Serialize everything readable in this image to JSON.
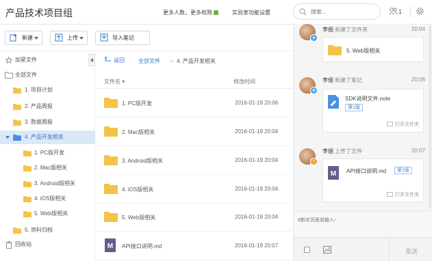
{
  "header": {
    "app_title": "产品技术项目组",
    "more_people_link": "更多人数，更多权限",
    "labs_link": "实验室功能设置",
    "search_placeholder": "搜索...",
    "member_count": "1"
  },
  "toolbar": {
    "new_label": "新建",
    "upload_label": "上传",
    "import_label": "导入笔记"
  },
  "sidebar": {
    "items": [
      {
        "label": "加星文件",
        "icon": "star-icon"
      },
      {
        "label": "全部文件",
        "icon": "folder-outline-icon"
      },
      {
        "label": "1. 项目计划",
        "icon": "folder-icon"
      },
      {
        "label": "2. 产品周报",
        "icon": "folder-icon"
      },
      {
        "label": "3. 数据周报",
        "icon": "folder-icon"
      },
      {
        "label": "4. 产品开发相关",
        "icon": "folder-open-icon",
        "active": true
      },
      {
        "label": "1. PC版开发",
        "icon": "folder-icon"
      },
      {
        "label": "2. Mac版相关",
        "icon": "folder-icon"
      },
      {
        "label": "3. Android版相关",
        "icon": "folder-icon"
      },
      {
        "label": "4. iOS版相关",
        "icon": "folder-icon"
      },
      {
        "label": "5. Web版相关",
        "icon": "folder-icon"
      },
      {
        "label": "5. 资料归档",
        "icon": "folder-icon"
      },
      {
        "label": "回收站",
        "icon": "trash-icon"
      }
    ]
  },
  "breadcrumb": {
    "back_label": "返回",
    "all_label": "全部文件",
    "arrow": "→",
    "current_label": "4. 产品开发相关"
  },
  "file_list": {
    "col_name": "文件名 ▾",
    "col_time": "修改时间",
    "rows": [
      {
        "name": "1. PC版开发",
        "time": "2016-01-19 20:06",
        "type": "folder"
      },
      {
        "name": "2. Mac版相关",
        "time": "2016-01-19 20:04",
        "type": "folder"
      },
      {
        "name": "3. Android版相关",
        "time": "2016-01-19 20:04",
        "type": "folder"
      },
      {
        "name": "4. iOS版相关",
        "time": "2016-01-19 20:04",
        "type": "folder"
      },
      {
        "name": "5. Web版相关",
        "time": "2016-01-19 20:04",
        "type": "folder"
      },
      {
        "name": "API接口说明.md",
        "time": "2016-01-19 20:07",
        "type": "markdown"
      }
    ]
  },
  "activity": {
    "items": [
      {
        "user": "李倔",
        "action": "新建了文件夹",
        "time": "20:04",
        "file": "5. Web版相关"
      },
      {
        "user": "李倔",
        "action": "新建了笔记",
        "time": "20:06",
        "file": "SDK说明文件.note",
        "version": "第1版",
        "open_folder": "打开文件夹"
      },
      {
        "user": "李倔",
        "action": "上传了文件",
        "time": "20:07",
        "file": "API接口说明.md",
        "version": "第1版",
        "open_folder": "打开文件夹"
      }
    ]
  },
  "comment": {
    "placeholder": "#新欢页面说输入~",
    "send_label": "发送"
  },
  "colors": {
    "accent": "#3a78c2",
    "folder": "#f5c349",
    "active_bg": "#dbe8f6",
    "note_blue": "#4a90e2",
    "md_purple": "#6a5a8c"
  }
}
